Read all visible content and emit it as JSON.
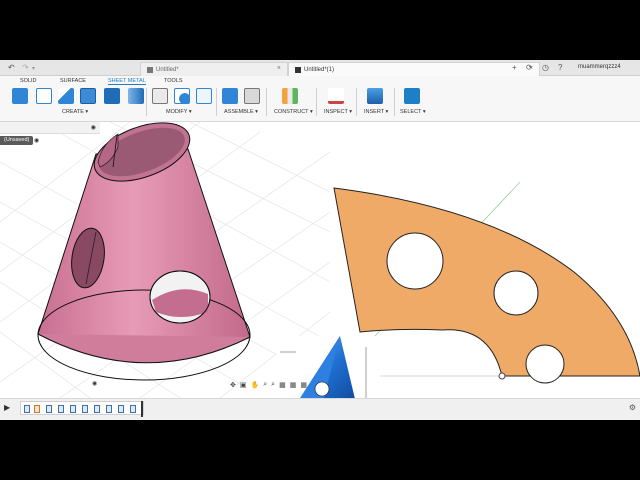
{
  "tabs": {
    "left_title": "Untitled*",
    "right_title": "Untitled*(1)"
  },
  "user": {
    "name": "muammerqzzz4"
  },
  "ribbon": {
    "tabs": [
      "SOLID",
      "SURFACE",
      "SHEET METAL",
      "TOOLS"
    ],
    "active_tab": "SHEET METAL",
    "groups": [
      "CREATE ▾",
      "MODIFY ▾",
      "ASSEMBLE ▾",
      "CONSTRUCT ▾",
      "INSPECT ▾",
      "INSERT ▾",
      "SELECT ▾"
    ]
  },
  "browser": {
    "unsaved_label": "(Unsaved)"
  },
  "colors": {
    "cone": "#d98aa6",
    "flat_pattern": "#eeaa66",
    "accent": "#1f7fc4"
  },
  "icons": {
    "undo": "undo-icon",
    "redo": "redo-icon",
    "close": "close-icon",
    "add_tab": "plus-icon",
    "refresh": "refresh-icon",
    "help": "help-icon",
    "settings": "gear-icon"
  }
}
